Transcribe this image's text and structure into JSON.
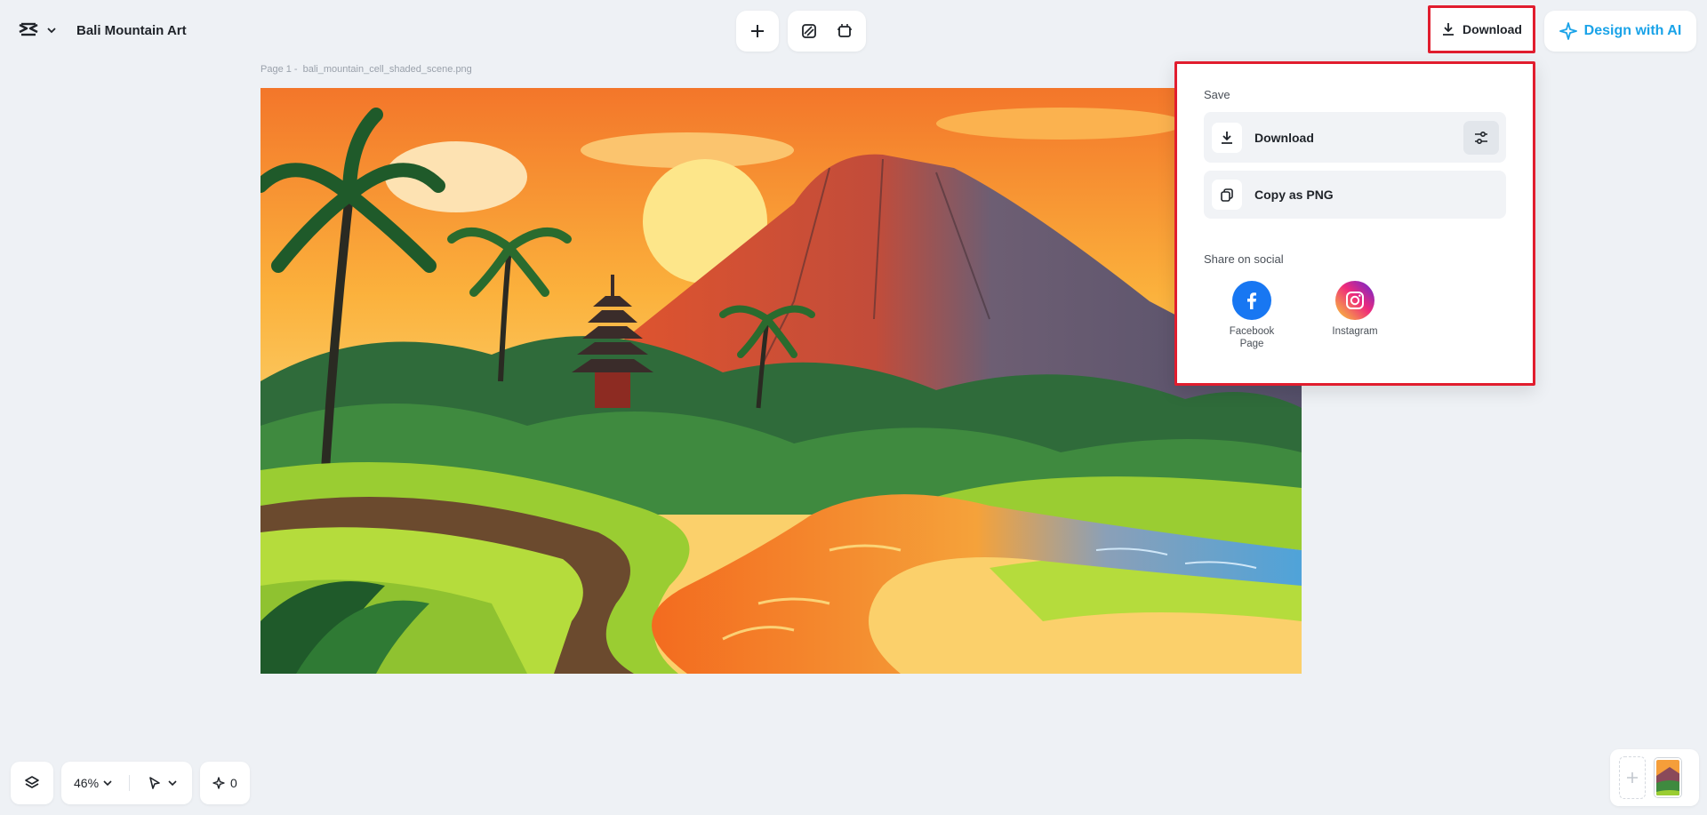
{
  "header": {
    "project_title": "Bali Mountain Art",
    "download_label": "Download",
    "design_ai_label": "Design with AI"
  },
  "page": {
    "page_label": "Page 1 -",
    "file_name": "bali_mountain_cell_shaded_scene.png"
  },
  "download_panel": {
    "save_section": "Save",
    "download_item": "Download",
    "copy_item": "Copy as PNG",
    "share_section": "Share on social",
    "social": [
      {
        "label": "Facebook Page",
        "icon": "facebook-icon"
      },
      {
        "label": "Instagram",
        "icon": "instagram-icon"
      }
    ]
  },
  "bottom_toolbar": {
    "zoom": "46%",
    "ai_count": "0"
  },
  "colors": {
    "highlight": "#e11d2e",
    "accent": "#1aa3e8",
    "facebook": "#1877f2",
    "background": "#eef1f5"
  }
}
